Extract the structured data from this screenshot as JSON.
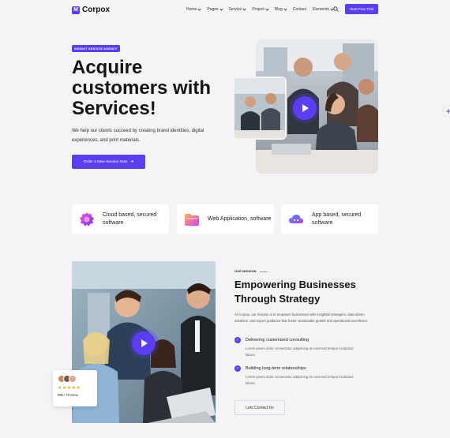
{
  "brand": {
    "name": "Corpox",
    "mark": "M",
    "accent": "#5b3df5"
  },
  "nav": {
    "items": [
      {
        "label": "Home",
        "dropdown": true
      },
      {
        "label": "Pages",
        "dropdown": true
      },
      {
        "label": "Service",
        "dropdown": true
      },
      {
        "label": "Project",
        "dropdown": true
      },
      {
        "label": "Blog",
        "dropdown": true
      },
      {
        "label": "Contact",
        "dropdown": false
      },
      {
        "label": "Elements",
        "dropdown": true
      }
    ],
    "search_icon": "search-icon",
    "cta_label": "Start Free Trial"
  },
  "hero": {
    "badge": "INSIGHT SERVICE AGENCY",
    "title": "Acquire customers with Services!",
    "description": "We help our clients succeed by creating brand identities, digital experiences, and print materials.",
    "cta_label": "Order a New Service Now",
    "cta_icon": "arrow-right-icon"
  },
  "features": [
    {
      "label": "Cloud based, secured software",
      "icon": "cloud-gear-icon"
    },
    {
      "label": "Web Application, software",
      "icon": "folder-icon"
    },
    {
      "label": "App based, secured software",
      "icon": "cloud-icon"
    }
  ],
  "mission": {
    "eyebrow": "OUR MISSION",
    "title": "Empowering Businesses Through Strategy",
    "description": "At Corpox, our mission is to empower businesses with insightful strategies, data-driven solutions, and expert guidance that foster sustainable growth and operational excellence.",
    "checks": [
      {
        "title": "Delivering customized consulting",
        "text": "Lorem ipsum dolor consectetur adipiscing do eiusmod tempor incididunt labore."
      },
      {
        "title": "Building long-term relationships",
        "text": "Lorem ipsum dolor consectetur adipiscing do eiusmod tempor incididunt labore."
      }
    ],
    "contact_label": "Lets Contact Us",
    "review": {
      "stars": "★★★★★",
      "text": "99k+ Review"
    }
  }
}
